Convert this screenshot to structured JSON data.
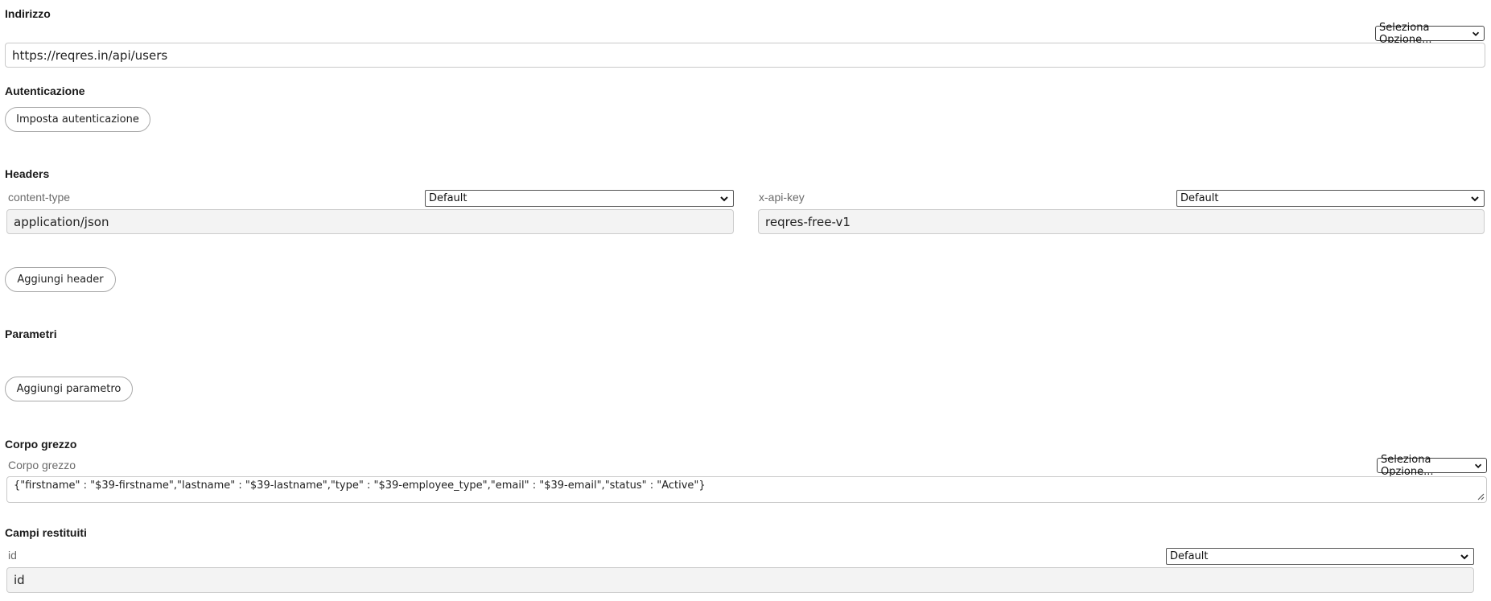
{
  "address": {
    "title": "Indirizzo",
    "option_select": "Seleziona Opzione...",
    "url_value": "https://reqres.in/api/users"
  },
  "auth": {
    "title": "Autenticazione",
    "button_label": "Imposta autenticazione"
  },
  "headers": {
    "title": "Headers",
    "items": [
      {
        "label": "content-type",
        "select": "Default",
        "value": "application/json"
      },
      {
        "label": "x-api-key",
        "select": "Default",
        "value": "reqres-free-v1"
      }
    ],
    "add_button_label": "Aggiungi header"
  },
  "params": {
    "title": "Parametri",
    "add_button_label": "Aggiungi parametro"
  },
  "raw_body": {
    "title": "Corpo grezzo",
    "label": "Corpo grezzo",
    "option_select": "Seleziona Opzione...",
    "value": "{\"firstname\" : \"$39-firstname\",\"lastname\" : \"$39-lastname\",\"type\" : \"$39-employee_type\",\"email\" : \"$39-email\",\"status\" : \"Active\"}"
  },
  "returned_fields": {
    "title": "Campi restituiti",
    "items": [
      {
        "label": "id",
        "select": "Default",
        "value": "id"
      }
    ]
  },
  "icons": {
    "dropdown": "chevron-down-icon",
    "resize": "resize-grip-icon"
  },
  "colors": {
    "readonly_bg": "#f3f3f3",
    "border": "#c9c9c9",
    "label_gray": "#6b6b6b"
  }
}
